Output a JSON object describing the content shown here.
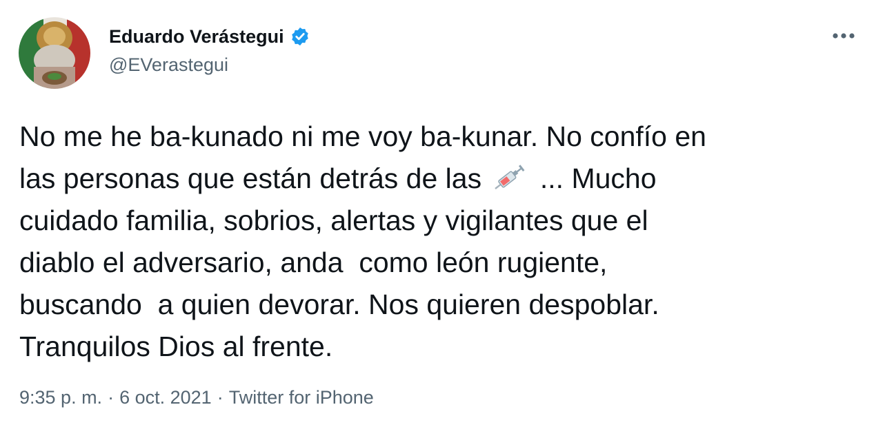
{
  "author": {
    "display_name": "Eduardo Verástegui",
    "handle": "@EVerastegui",
    "verified": true,
    "avatar_icon": "avatar-flag-portrait"
  },
  "tweet": {
    "text_parts": {
      "before_emoji": "No me he ba-kunado ni me voy ba-kunar. No confío en\nlas personas que están detrás de las ",
      "emoji": "syringe-icon",
      "after_emoji": " ... Mucho\ncuidado familia, sobrios, alertas y vigilantes que el\ndiablo el adversario, anda  como león rugiente,\nbuscando  a quien devorar. Nos quieren despoblar.\nTranquilos Dios al frente."
    }
  },
  "meta": {
    "time": "9:35 p. m.",
    "separator": "·",
    "date": "6 oct. 2021",
    "source": "Twitter for iPhone"
  },
  "colors": {
    "text": "#0f1419",
    "secondary": "#536471",
    "verified_blue": "#1d9bf0"
  },
  "icons": {
    "more": "more-options-icon",
    "verified": "verified-badge-icon"
  }
}
